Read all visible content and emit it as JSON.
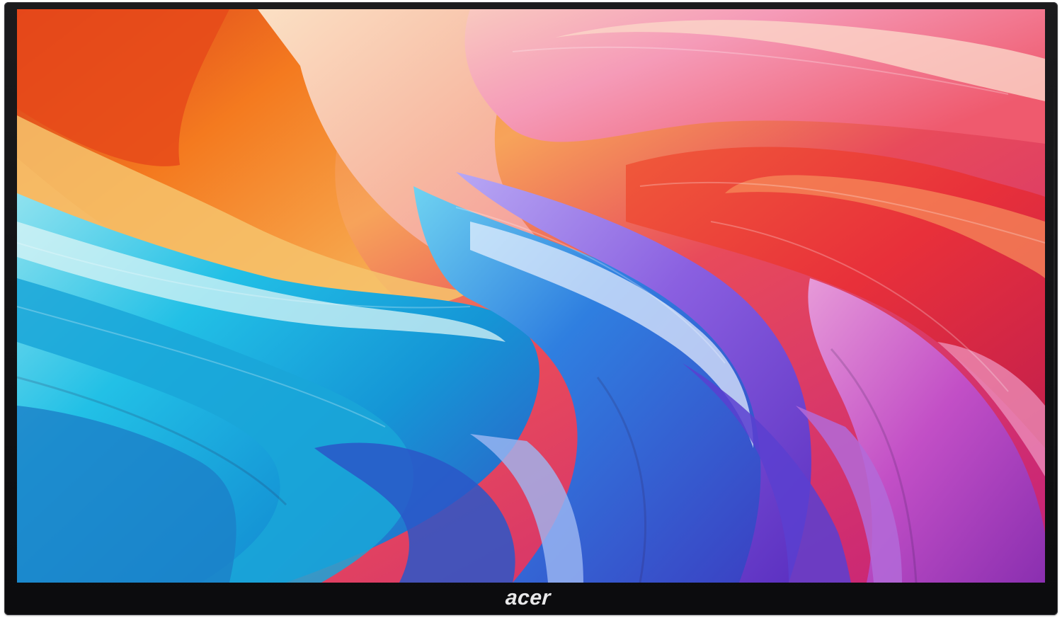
{
  "product": {
    "brand": "acer",
    "wallpaper": "abstract-colorful-swirl",
    "colors": {
      "bezel": "#111113",
      "logo": "#e9e9ea",
      "orange": "#f47a1f",
      "red": "#e8303a",
      "pink": "#f59bb8",
      "cyan": "#22c0e6",
      "blue": "#2f7fe0",
      "purple": "#8a5fe0"
    }
  }
}
